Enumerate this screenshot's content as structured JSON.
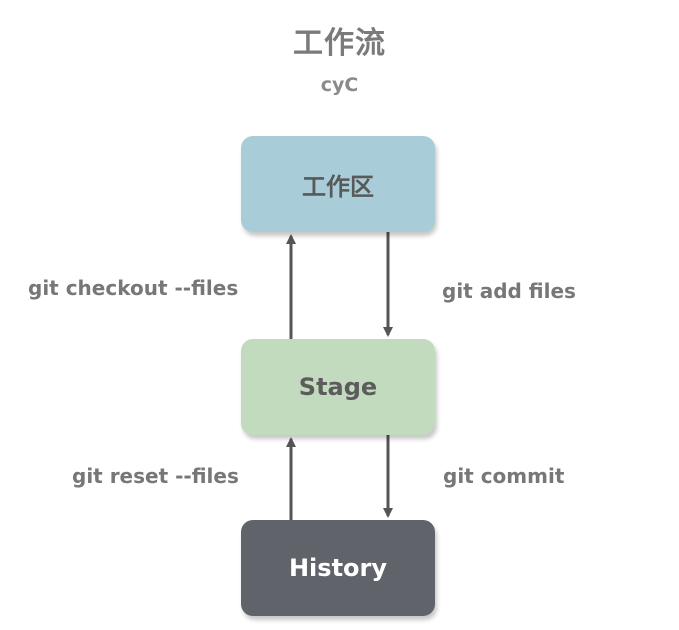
{
  "title": "工作流",
  "subtitle": "cyC",
  "nodes": {
    "work": "工作区",
    "stage": "Stage",
    "history": "History"
  },
  "edges": {
    "checkout": "git checkout --files",
    "add": "git add files",
    "reset": "git reset --files",
    "commit": "git commit"
  },
  "colors": {
    "work": "#a9cdd8",
    "stage": "#c2dbbe",
    "history": "#60636a",
    "arrow": "#555555",
    "label": "#777777"
  }
}
